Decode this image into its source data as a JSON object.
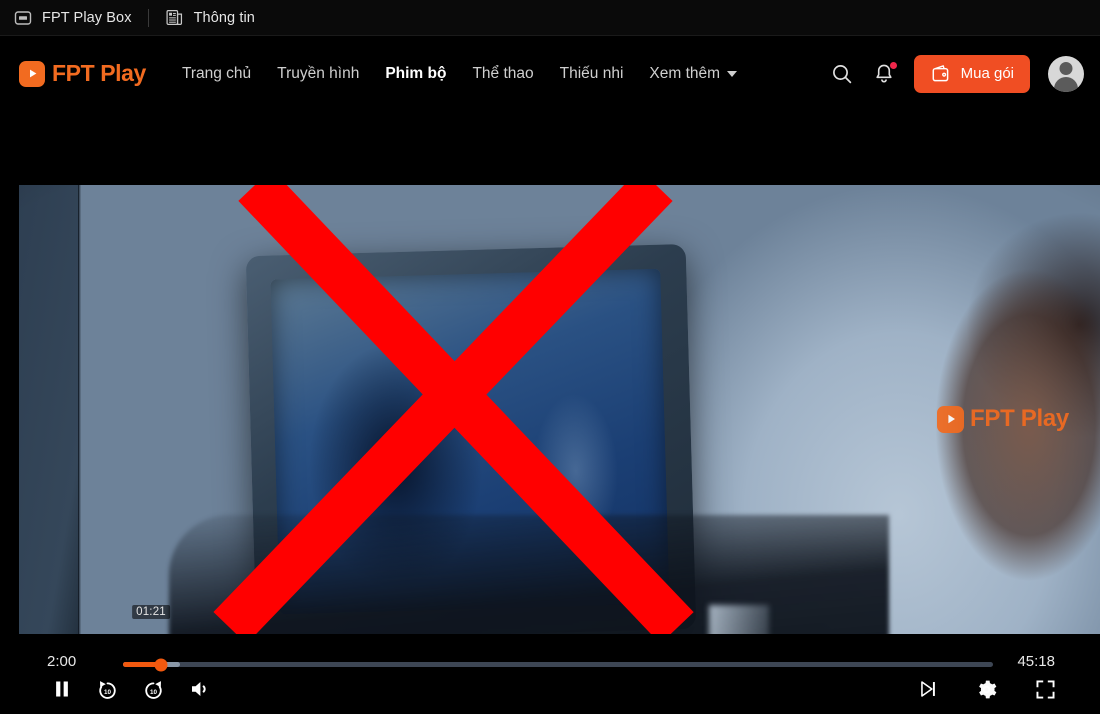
{
  "topbar": {
    "items": [
      {
        "icon": "box-icon",
        "label": "FPT Play Box"
      },
      {
        "icon": "document-icon",
        "label": "Thông tin"
      }
    ]
  },
  "nav": {
    "brand": {
      "icon": "play-icon",
      "text": "FPT Play"
    },
    "links": [
      {
        "label": "Trang chủ",
        "active": false
      },
      {
        "label": "Truyền hình",
        "active": false
      },
      {
        "label": "Phim bộ",
        "active": true
      },
      {
        "label": "Thể thao",
        "active": false
      },
      {
        "label": "Thiếu nhi",
        "active": false
      }
    ],
    "more_label": "Xem thêm",
    "search_icon": "search-icon",
    "notification_icon": "bell-icon",
    "buy_button": {
      "icon": "wallet-icon",
      "label": "Mua gói"
    },
    "avatar": "user-avatar"
  },
  "player": {
    "watermark": {
      "icon": "play-icon",
      "text": "FPT Play"
    },
    "overlay_mark": "red-x-overlay",
    "controls": {
      "current_time": "2:00",
      "total_time": "45:18",
      "hover_time": "01:21",
      "progress_percent": 4.4,
      "buffered_percent": 6.6,
      "play_pause_icon": "pause-icon",
      "rewind_icon": "rewind-10-icon",
      "forward_icon": "forward-10-icon",
      "volume_icon": "volume-icon",
      "next_icon": "next-episode-icon",
      "settings_icon": "gear-icon",
      "fullscreen_icon": "fullscreen-icon"
    }
  },
  "colors": {
    "brand_orange": "#F26B20",
    "button_orange": "#F04E23",
    "progress_orange": "#F2590F",
    "overlay_red": "#FF0000",
    "notification_red": "#F0274B"
  }
}
